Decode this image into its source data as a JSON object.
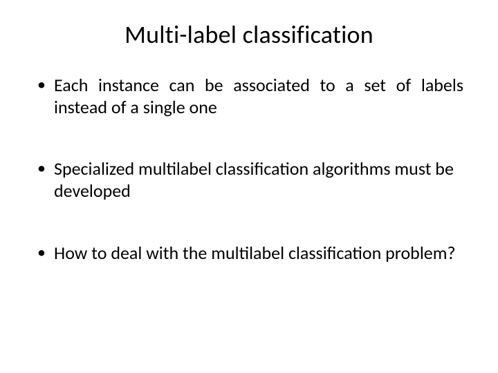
{
  "slide": {
    "title": "Multi-label classification",
    "bullets": [
      "Each instance can be associated to a set of labels instead of a single one",
      "Specialized multilabel classification algorithms must be developed",
      "How to deal with the multilabel classification problem?"
    ]
  }
}
